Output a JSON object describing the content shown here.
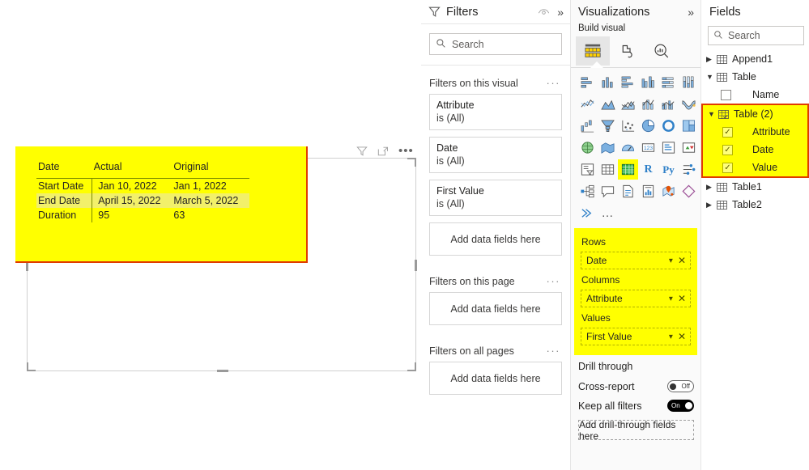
{
  "canvas": {
    "visual_toolbar": [
      {
        "name": "filter-icon",
        "tooltip": "Filters"
      },
      {
        "name": "focus-mode-icon",
        "tooltip": "Focus mode"
      },
      {
        "name": "more-options-icon",
        "tooltip": "More options",
        "glyph": "•••"
      }
    ],
    "matrix": {
      "columns": [
        "Date",
        "Actual",
        "Original"
      ],
      "rows": [
        {
          "label": "Start Date",
          "actual": "Jan 10, 2022",
          "original": "Jan 1, 2022",
          "hover": false
        },
        {
          "label": "End Date",
          "actual": "April 15, 2022",
          "original": "March 5, 2022",
          "hover": true
        },
        {
          "label": "Duration",
          "actual": "95",
          "original": "63",
          "hover": false
        }
      ]
    }
  },
  "filters": {
    "title": "Filters",
    "header_icons": [
      {
        "name": "filter-funnel-icon"
      },
      {
        "name": "eye-icon"
      },
      {
        "name": "collapse-pane-icon",
        "glyph": "»"
      }
    ],
    "search_placeholder": "Search",
    "sections": [
      {
        "title": "Filters on this visual",
        "cards": [
          {
            "field": "Attribute",
            "condition": "is (All)"
          },
          {
            "field": "Date",
            "condition": "is (All)"
          },
          {
            "field": "First Value",
            "condition": "is (All)"
          }
        ],
        "dropzone": "Add data fields here"
      },
      {
        "title": "Filters on this page",
        "cards": [],
        "dropzone": "Add data fields here"
      },
      {
        "title": "Filters on all pages",
        "cards": [],
        "dropzone": "Add data fields here"
      }
    ],
    "section_menu_glyph": "···"
  },
  "visualizations": {
    "title": "Visualizations",
    "collapse_glyph": "»",
    "build_visual_label": "Build visual",
    "tabs": [
      {
        "name": "build-visual-tab",
        "icon": "fields-table-icon",
        "selected": true
      },
      {
        "name": "format-visual-tab",
        "icon": "paintbrush-icon",
        "selected": false
      },
      {
        "name": "analytics-tab",
        "icon": "magnifier-chart-icon",
        "selected": false
      }
    ],
    "visual_types": [
      "stacked-bar-chart-icon",
      "stacked-column-chart-icon",
      "clustered-bar-chart-icon",
      "clustered-column-chart-icon",
      "100-stacked-bar-chart-icon",
      "100-stacked-column-chart-icon",
      "line-chart-icon",
      "area-chart-icon",
      "stacked-area-chart-icon",
      "line-stacked-column-chart-icon",
      "line-clustered-column-chart-icon",
      "ribbon-chart-icon",
      "waterfall-chart-icon",
      "funnel-chart-icon",
      "scatter-chart-icon",
      "pie-chart-icon",
      "donut-chart-icon",
      "treemap-icon",
      "map-icon",
      "filled-map-icon",
      "gauge-icon",
      "card-icon",
      "multi-row-card-icon",
      "kpi-icon",
      "slicer-icon",
      "table-icon",
      "matrix-icon",
      "r-script-visual-icon",
      "python-visual-icon",
      "key-influencers-icon",
      "decomposition-tree-icon",
      "qa-visual-icon",
      "smart-narrative-icon",
      "paginated-report-icon",
      "arcgis-maps-icon",
      "power-apps-icon",
      "power-automate-icon",
      "more-visuals-icon"
    ],
    "selected_visual_type": "matrix-icon",
    "field_wells": [
      {
        "label": "Rows",
        "pills": [
          {
            "name": "Date"
          }
        ]
      },
      {
        "label": "Columns",
        "pills": [
          {
            "name": "Attribute"
          }
        ]
      },
      {
        "label": "Values",
        "pills": [
          {
            "name": "First Value"
          }
        ]
      }
    ],
    "drill_through": {
      "title": "Drill through",
      "cross_report": {
        "label": "Cross-report",
        "state": "Off"
      },
      "keep_all_filters": {
        "label": "Keep all filters",
        "state": "On"
      },
      "dropzone": "Add drill-through fields here"
    }
  },
  "fields": {
    "title": "Fields",
    "search_placeholder": "Search",
    "tree": [
      {
        "name": "Append1",
        "expanded": false,
        "highlighted": false,
        "children": []
      },
      {
        "name": "Table",
        "expanded": true,
        "highlighted": false,
        "children": [
          {
            "name": "Name",
            "checked": false
          }
        ]
      },
      {
        "name": "Table (2)",
        "expanded": true,
        "highlighted": true,
        "children": [
          {
            "name": "Attribute",
            "checked": true
          },
          {
            "name": "Date",
            "checked": true
          },
          {
            "name": "Value",
            "checked": true
          }
        ]
      },
      {
        "name": "Table1",
        "expanded": false,
        "highlighted": false,
        "children": []
      },
      {
        "name": "Table2",
        "expanded": false,
        "highlighted": false,
        "children": []
      }
    ]
  },
  "colors": {
    "highlight_yellow": "#ffff00",
    "highlight_border": "#e03c00",
    "row_hover": "#f2f06a",
    "matrix_rule": "#7a8b00",
    "pane_bg": "#fafafa"
  }
}
